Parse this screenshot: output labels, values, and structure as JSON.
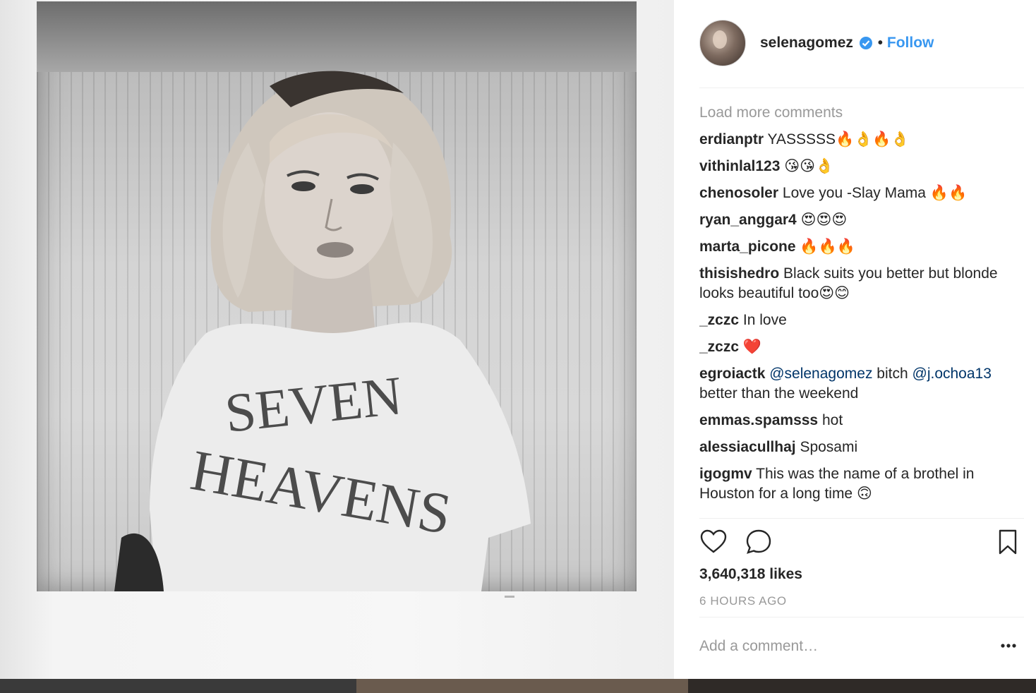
{
  "post": {
    "username": "selenagomez",
    "follow_label": "Follow",
    "separator": "•",
    "load_more": "Load more comments",
    "likes": "3,640,318 likes",
    "time": "6 HOURS AGO",
    "add_comment_placeholder": "Add a comment…"
  },
  "comments": [
    {
      "user": "erdianptr",
      "text": "YASSSSS🔥👌🔥👌"
    },
    {
      "user": "vithinlal123",
      "text": "😘😘👌"
    },
    {
      "user": "chenosoler",
      "text": "Love you -Slay Mama 🔥🔥"
    },
    {
      "user": "ryan_anggar4",
      "text": "😍😍😍"
    },
    {
      "user": "marta_picone",
      "text": "🔥🔥🔥"
    },
    {
      "user": "thisishedro",
      "text": "Black suits you better but blonde looks beautiful too😍😊"
    },
    {
      "user": "_zczc",
      "text": "In love"
    },
    {
      "user": "_zczc",
      "text": "❤️"
    },
    {
      "user": "egroiactk",
      "mention1": "@selenagomez",
      "mid": "bitch",
      "mention2": "@j.ochoa13",
      "text": "better than the weekend"
    },
    {
      "user": "emmas.spamsss",
      "text": "hot"
    },
    {
      "user": "alessiacullhaj",
      "text": "Sposami"
    },
    {
      "user": "igogmv",
      "text": "This was the name of a brothel in Houston for a long time 🙃"
    }
  ],
  "icons": {
    "like": "heart-icon",
    "comment": "comment-bubble-icon",
    "save": "bookmark-icon",
    "verified": "verified-badge-icon",
    "more": "more-options-icon"
  },
  "colors": {
    "link_blue": "#3897f0",
    "mention": "#003569",
    "muted": "#999999",
    "text": "#262626"
  }
}
